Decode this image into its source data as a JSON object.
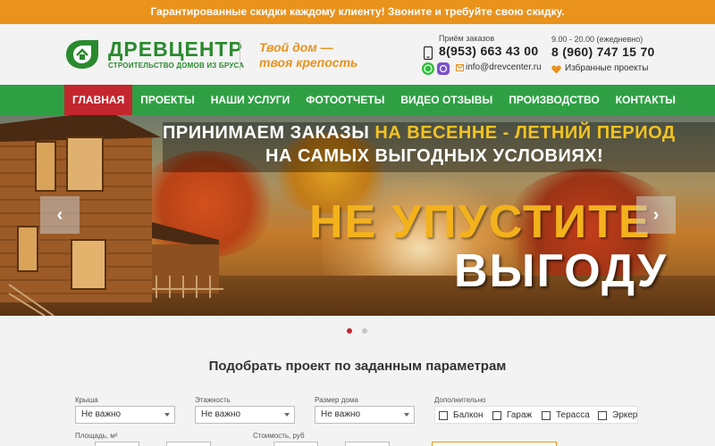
{
  "promo": {
    "text": "Гарантированные скидки каждому клиенту! Звоните и требуйте свою скидку."
  },
  "brand": {
    "name": "ДРЕВЦЕНТР",
    "subtitle": "СТРОИТЕЛЬСТВО ДОМОВ ИЗ БРУСА",
    "slogan_line1": "Твой дом —",
    "slogan_line2": "твоя крепость"
  },
  "contacts": {
    "label": "Приём заказов",
    "phone1": "8(953) 663 43 00",
    "email": "info@drevcenter.ru",
    "hours": "9.00 - 20.00 (ежедневно)",
    "phone2": "8 (960) 747 15 70",
    "favorites": "Избранные проекты"
  },
  "nav": {
    "items": [
      "ГЛАВНАЯ",
      "ПРОЕКТЫ",
      "НАШИ УСЛУГИ",
      "ФОТООТЧЕТЫ",
      "ВИДЕО ОТЗЫВЫ",
      "ПРОИЗВОДСТВО",
      "КОНТАКТЫ"
    ],
    "active_index": 0
  },
  "slider": {
    "line1_prefix": "ПРИНИМАЕМ ЗАКАЗЫ ",
    "line1_highlight": "НА ВЕСЕННЕ - ЛЕТНИЙ ПЕРИОД",
    "line2": "НА САМЫХ ВЫГОДНЫХ УСЛОВИЯХ!",
    "big_line1": "НЕ УПУСТИТЕ",
    "big_line2": "ВЫГОДУ",
    "prev_symbol": "‹",
    "next_symbol": "›",
    "active_slide": 1,
    "slide_count": 2
  },
  "filter": {
    "title": "Подобрать проект по заданным параметрам",
    "roof_label": "Крыша",
    "roof_value": "Не важно",
    "floors_label": "Этажность",
    "floors_value": "Не важно",
    "size_label": "Размер дома",
    "size_value": "Не важно",
    "extra_label": "Дополнительно",
    "extras": [
      "Балкон",
      "Гараж",
      "Терасса",
      "Эркер"
    ],
    "area_label": "Площадь, м²",
    "price_label": "Стоимость, руб"
  },
  "colors": {
    "promo": "#e9921c",
    "nav": "#2ea043",
    "nav_active": "#c4262e",
    "brand": "#2a8a2e",
    "highlight": "#f3c321"
  }
}
